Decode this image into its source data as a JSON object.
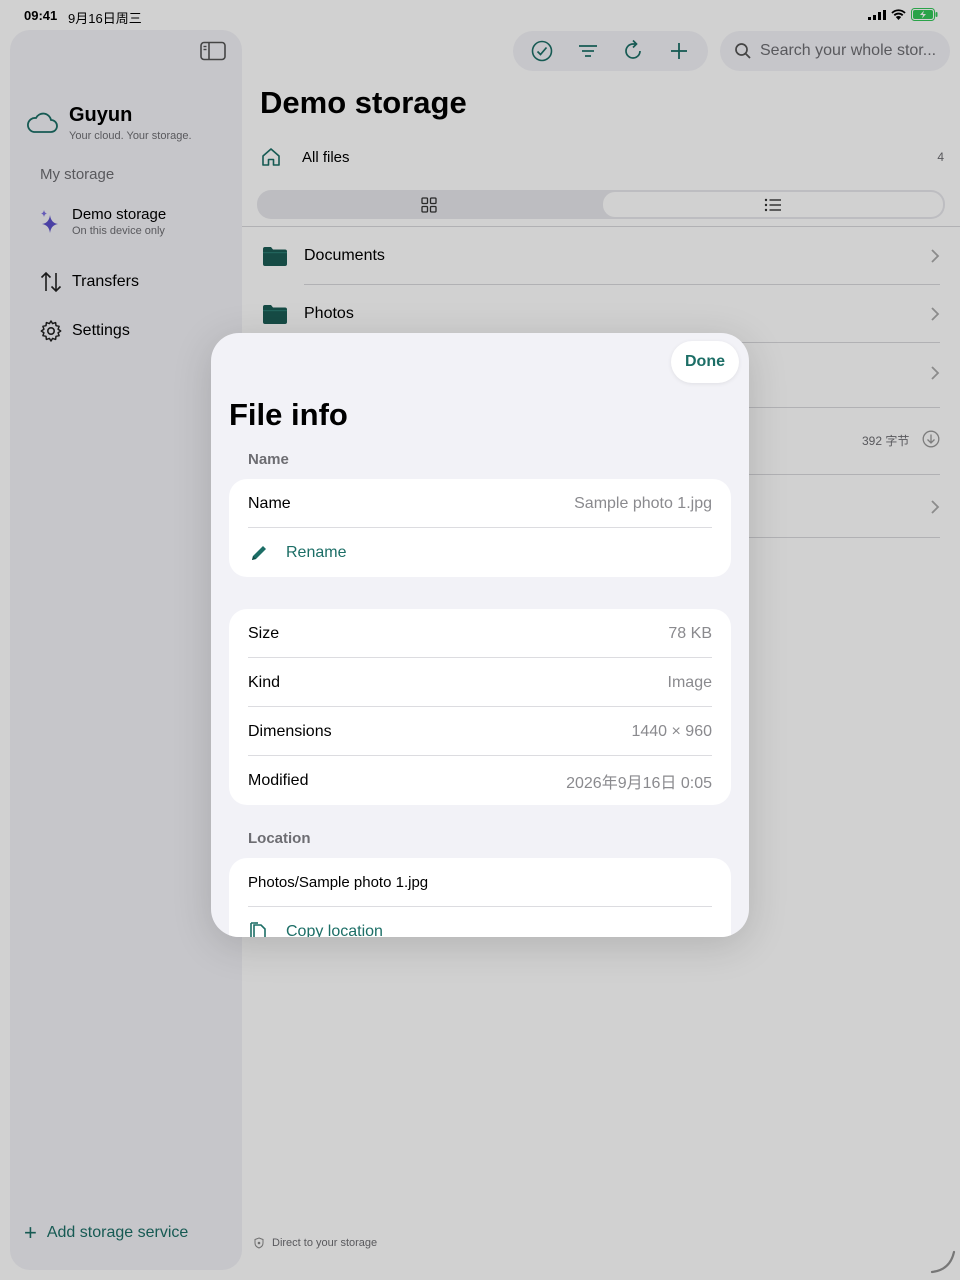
{
  "status": {
    "time": "09:41",
    "date": "9月16日周三"
  },
  "sidebar": {
    "app_name": "Guyun",
    "tagline": "Your cloud. Your storage.",
    "section": "My storage",
    "storage_item": {
      "label": "Demo storage",
      "sub": "On this device only"
    },
    "transfers": "Transfers",
    "settings": "Settings",
    "add_storage": "Add storage service"
  },
  "main": {
    "title": "Demo storage",
    "search_placeholder": "Search your whole stor...",
    "crumb": "All files",
    "count": "4",
    "rows": [
      "Documents",
      "Photos"
    ],
    "file_size": "392 字节",
    "footer": "Direct to your storage"
  },
  "modal": {
    "done": "Done",
    "title": "File info",
    "name_section": "Name",
    "name_label": "Name",
    "name_value": "Sample photo 1.jpg",
    "rename": "Rename",
    "size_label": "Size",
    "size_value": "78 KB",
    "kind_label": "Kind",
    "kind_value": "Image",
    "dim_label": "Dimensions",
    "dim_value": "1440 × 960",
    "mod_label": "Modified",
    "mod_value": "2026年9月16日 0:05",
    "location_section": "Location",
    "location_value": "Photos/Sample photo 1.jpg",
    "copy_location": "Copy location"
  },
  "colors": {
    "accent": "#1c6e66",
    "sparkle": "#5b4fc9"
  }
}
